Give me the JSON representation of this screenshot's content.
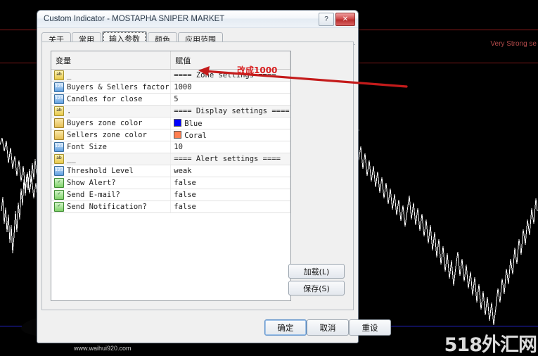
{
  "chart": {
    "background_color": "#000000",
    "candle_color": "#ffffff",
    "zone_line_color": "#8b1a1a",
    "support_line_color": "#2222cc",
    "label_very_strong": "Very Strong se",
    "watermark_right": "518外汇网",
    "watermark_url": "www.waihui920.com"
  },
  "dialog": {
    "title": "Custom Indicator - MOSTAPHA SNIPER MARKET",
    "help_button": "?",
    "close_button": "✕",
    "tabs": [
      {
        "label": "关于",
        "active": false
      },
      {
        "label": "常用",
        "active": false
      },
      {
        "label": "输入参数",
        "active": true
      },
      {
        "label": "颜色",
        "active": false
      },
      {
        "label": "应用范围",
        "active": false
      }
    ],
    "grid": {
      "headers": [
        "变量",
        "赋值"
      ],
      "rows": [
        {
          "icon": "string-icon",
          "icon_glyph": "ab",
          "name": "_",
          "value": "==== Zone settings ====",
          "separator": true
        },
        {
          "icon": "integer-icon",
          "icon_glyph": "123",
          "name": "Buyers & Sellers factor",
          "value": "1000",
          "separator": false
        },
        {
          "icon": "integer-icon",
          "icon_glyph": "123",
          "name": "Candles for close",
          "value": "5",
          "separator": false
        },
        {
          "icon": "string-icon",
          "icon_glyph": "ab",
          "name": ".",
          "value": "==== Display settings ====",
          "separator": true
        },
        {
          "icon": "color-icon",
          "icon_glyph": "",
          "name": "Buyers zone color",
          "value": "Blue",
          "swatch": "#0000ff",
          "separator": false
        },
        {
          "icon": "color-icon",
          "icon_glyph": "",
          "name": "Sellers zone color",
          "value": "Coral",
          "swatch": "#ff7f50",
          "separator": false
        },
        {
          "icon": "integer-icon",
          "icon_glyph": "123",
          "name": "Font Size",
          "value": "10",
          "separator": false
        },
        {
          "icon": "string-icon",
          "icon_glyph": "ab",
          "name": "__",
          "value": "==== Alert settings ====",
          "separator": true
        },
        {
          "icon": "integer-icon",
          "icon_glyph": "123",
          "name": "Threshold Level",
          "value": "weak",
          "separator": false
        },
        {
          "icon": "bool-icon",
          "icon_glyph": "✓",
          "name": "Show Alert?",
          "value": "false",
          "separator": false
        },
        {
          "icon": "bool-icon",
          "icon_glyph": "✓",
          "name": "Send E-mail?",
          "value": "false",
          "separator": false
        },
        {
          "icon": "bool-icon",
          "icon_glyph": "✓",
          "name": "Send Notification?",
          "value": "false",
          "separator": false
        }
      ]
    },
    "side_buttons": {
      "load": "加载(L)",
      "save": "保存(S)"
    },
    "footer_buttons": {
      "ok": "确定",
      "cancel": "取消",
      "reset": "重设"
    }
  },
  "annotation": {
    "text": "改成1000",
    "color": "#d81f1f"
  }
}
